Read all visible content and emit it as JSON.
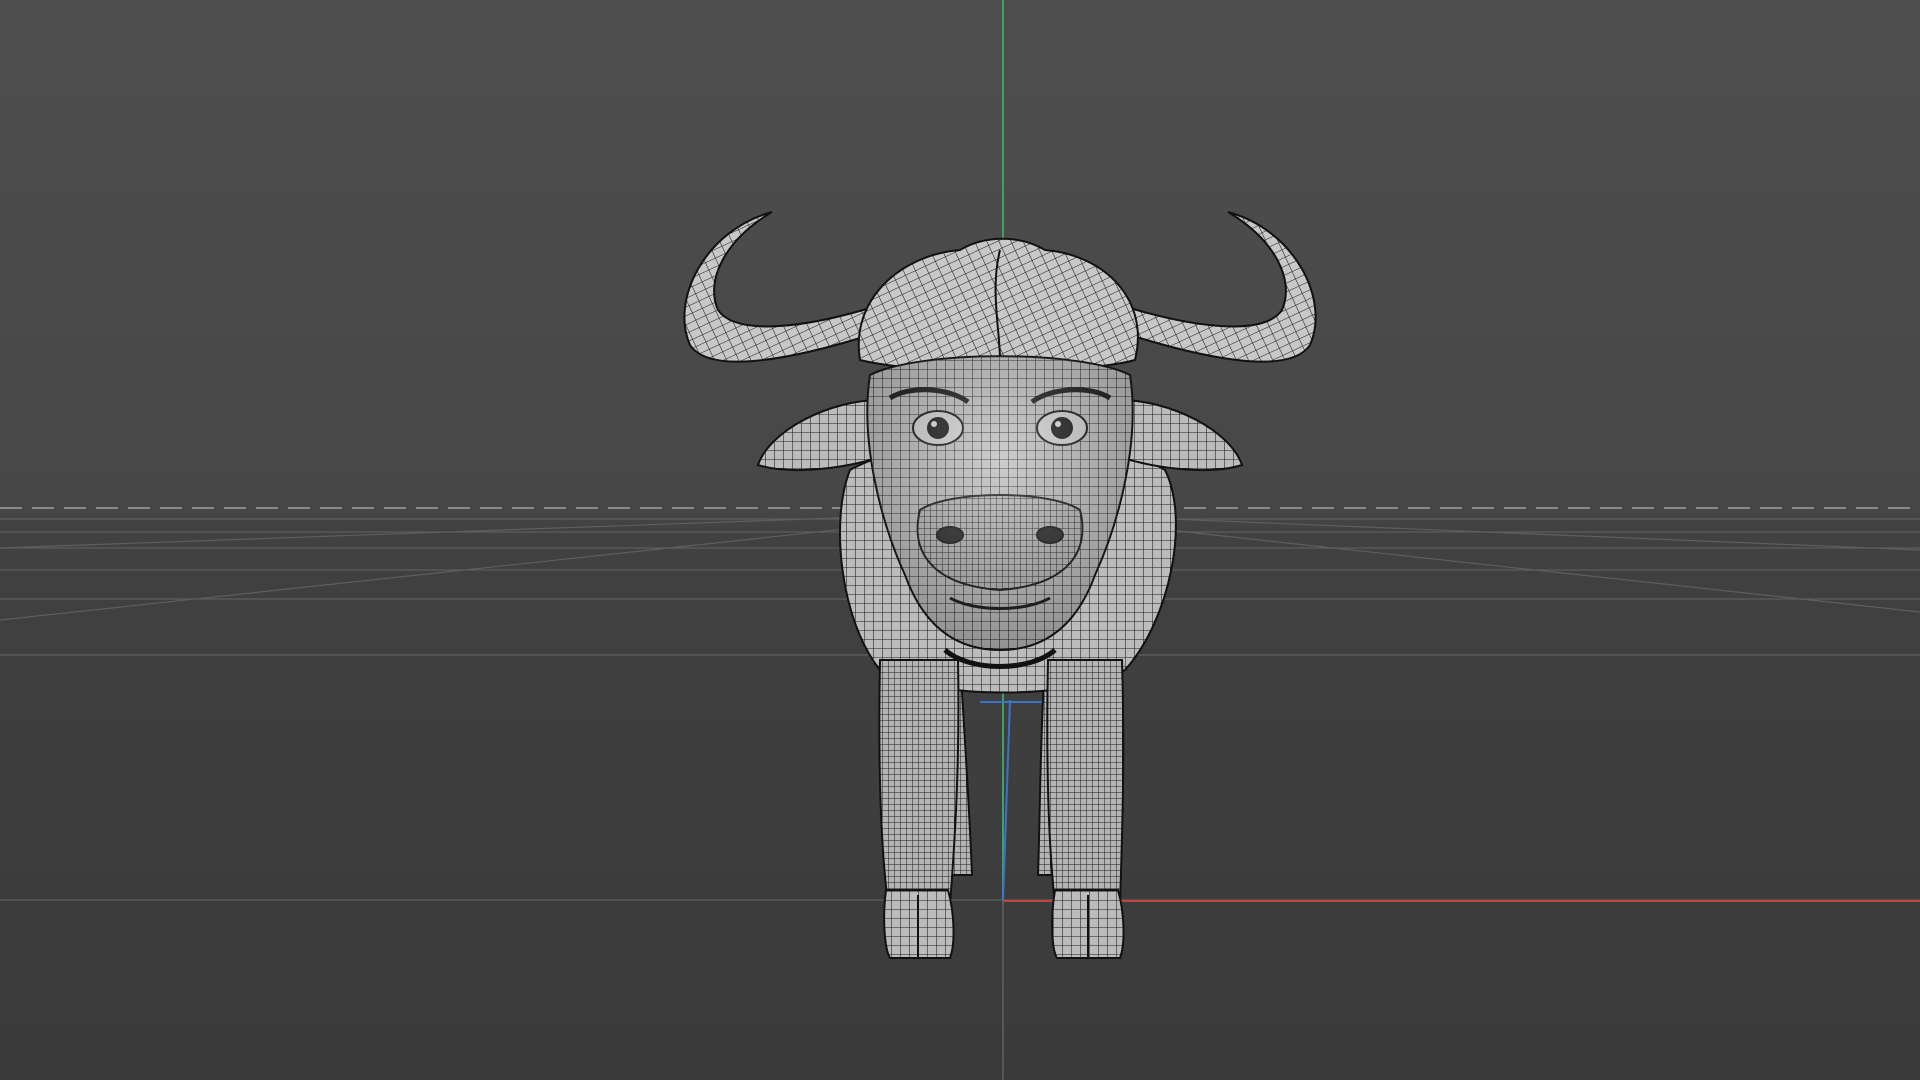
{
  "viewport": {
    "name": "3d-viewport",
    "background_top": "#4a4a4a",
    "background_floor": "#3c3c3c",
    "grid_line_color": "#6a6a6a",
    "horizon_color": "#8a8a8a"
  },
  "axes": {
    "x_axis_color": "#c0443b",
    "y_axis_color": "#3ea361",
    "z_axis_color": "#3b73c9"
  },
  "model": {
    "subject": "cape-buffalo",
    "display_mode": "wireframe-on-shaded",
    "shade_color": "#bdbdbd",
    "wire_color": "#1a1a1a"
  }
}
